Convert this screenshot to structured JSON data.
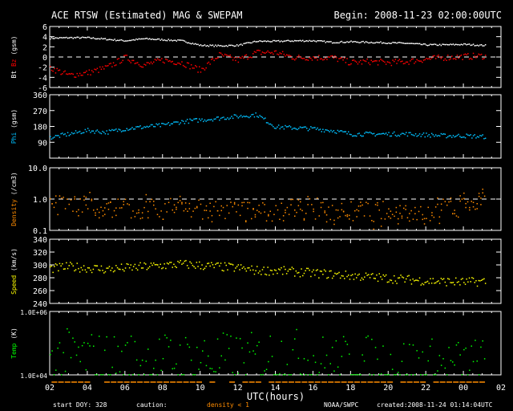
{
  "chart_data": [
    {
      "type": "scatter",
      "id": "mag",
      "title": "ACE RTSW (Estimated) MAG & SWEPAM",
      "begin": "Begin: 2008-11-23 02:00:00UTC",
      "ylabel_parts": [
        "Bt ",
        "Bz",
        " (gsm)"
      ],
      "ylim": [
        -6,
        6
      ],
      "yticks": [
        "6",
        "4",
        "2",
        "0",
        "-2",
        "-4",
        "-6"
      ],
      "ytick_values": [
        6,
        4,
        2,
        0,
        -2,
        -4,
        -6
      ],
      "ref_line": 0,
      "series": [
        {
          "name": "Bt",
          "color": "#ffffff",
          "hourly": [
            3.8,
            3.9,
            3.9,
            3.6,
            3.3,
            3.7,
            3.5,
            3.3,
            2.4,
            2.3,
            2.4,
            3.2,
            3.2,
            3.3,
            3.3,
            3.0,
            3.1,
            3.0,
            2.9,
            2.8,
            2.5,
            2.5,
            2.6,
            2.4
          ],
          "spread": 0.15
        },
        {
          "name": "Bz",
          "color": "#ff0000",
          "hourly": [
            -2,
            -3.5,
            -3,
            -2,
            0,
            -1.5,
            -0.5,
            -1,
            -2.5,
            0.5,
            -0.5,
            1,
            1,
            0,
            0,
            0,
            -1,
            -0.8,
            -1,
            -0.8,
            -0.3,
            0,
            0.2,
            0.3
          ],
          "spread": 0.6
        }
      ]
    },
    {
      "type": "scatter",
      "id": "phi",
      "ylabel_parts": [
        "Phi",
        " (gsm)"
      ],
      "label_color": "#00c0ff",
      "ylim": [
        0,
        360
      ],
      "yticks": [
        "360",
        "270",
        "180",
        "90"
      ],
      "ytick_values": [
        360,
        270,
        180,
        90
      ],
      "series": [
        {
          "name": "Phi",
          "color": "#00c0ff",
          "hourly": [
            120,
            140,
            160,
            150,
            170,
            180,
            190,
            210,
            220,
            230,
            240,
            250,
            180,
            175,
            170,
            160,
            140,
            140,
            140,
            140,
            135,
            130,
            130,
            125
          ],
          "spread": 12
        }
      ]
    },
    {
      "type": "scatter",
      "id": "density",
      "scale": "log",
      "ylabel_parts": [
        "Density",
        " (/cm3)"
      ],
      "label_color": "#ff8c00",
      "ylim": [
        0.1,
        10
      ],
      "yticks": [
        "10.0",
        "1.0",
        "0.1"
      ],
      "ytick_values": [
        10,
        1,
        0.1
      ],
      "ref_line": 1,
      "series": [
        {
          "name": "Density",
          "color": "#ff8c00",
          "hourly": [
            0.6,
            0.7,
            0.8,
            0.6,
            0.5,
            0.5,
            0.5,
            0.5,
            0.5,
            0.5,
            0.5,
            0.4,
            0.4,
            0.5,
            0.5,
            0.5,
            0.4,
            0.4,
            0.4,
            0.4,
            0.4,
            0.5,
            0.5,
            1.3
          ],
          "spread": 0.35
        }
      ]
    },
    {
      "type": "scatter",
      "id": "speed",
      "ylabel_parts": [
        "Speed",
        " (km/s)"
      ],
      "label_color": "#ffff00",
      "ylim": [
        240,
        340
      ],
      "yticks": [
        "340",
        "320",
        "300",
        "280",
        "260",
        "240"
      ],
      "ytick_values": [
        340,
        320,
        300,
        280,
        260,
        240
      ],
      "series": [
        {
          "name": "Speed",
          "color": "#ffff00",
          "hourly": [
            295,
            298,
            296,
            294,
            296,
            298,
            300,
            302,
            300,
            298,
            296,
            292,
            292,
            290,
            288,
            286,
            284,
            282,
            280,
            278,
            276,
            275,
            274,
            275
          ],
          "spread": 7
        }
      ]
    },
    {
      "type": "scatter",
      "id": "temp",
      "scale": "log",
      "ylabel_parts": [
        "Temp",
        " (K)"
      ],
      "label_color": "#00ff00",
      "ylim": [
        10000,
        1000000
      ],
      "yticks": [
        "1.0E+06",
        "1.0E+04"
      ],
      "ytick_values": [
        1000000,
        10000
      ],
      "series": [
        {
          "name": "Temp",
          "color": "#00ff00",
          "hourly": [
            30000,
            40000,
            35000,
            30000,
            30000,
            28000,
            30000,
            30000,
            35000,
            30000,
            30000,
            30000,
            45000,
            40000,
            30000,
            25000,
            25000,
            25000,
            22000,
            22000,
            20000,
            20000,
            20000,
            20000
          ],
          "spread": 0.45
        }
      ]
    }
  ],
  "xaxis": {
    "label": "UTC(hours)",
    "ticks": [
      "02",
      "04",
      "06",
      "08",
      "10",
      "12",
      "14",
      "16",
      "18",
      "20",
      "22",
      "00",
      "02"
    ],
    "range_hours": [
      0,
      24
    ],
    "data_end_hours": 23.2
  },
  "footer": {
    "start_doy": "start DOY: 328",
    "caution": "caution:",
    "density_note": "density < 1",
    "source": "NOAA/SWPC",
    "created": "created:2008-11-24 01:14:04UTC"
  },
  "colors": {
    "caution": "#ff8c00"
  }
}
